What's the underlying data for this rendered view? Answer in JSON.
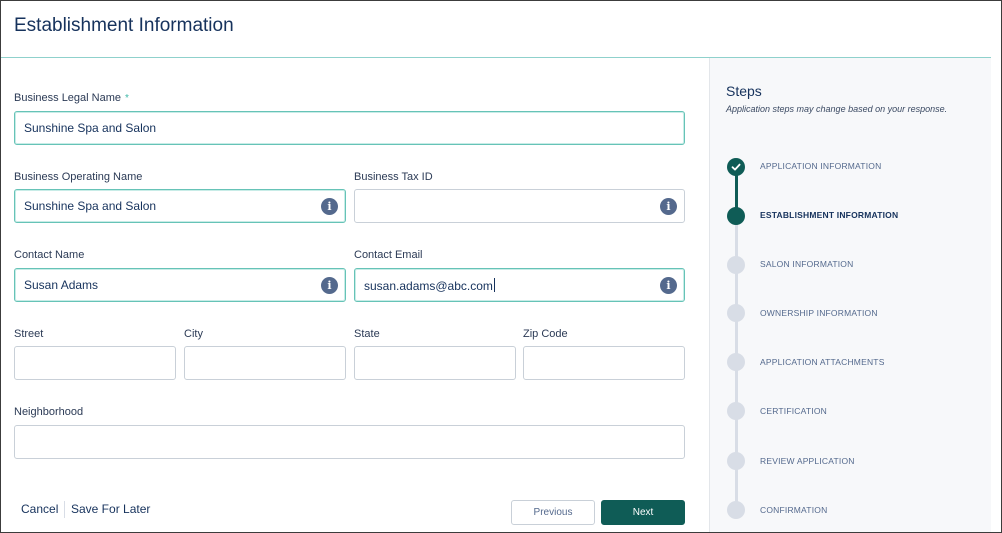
{
  "page": {
    "title": "Establishment Information"
  },
  "form": {
    "business_legal_name": {
      "label": "Business Legal Name",
      "required_mark": "*",
      "value": "Sunshine Spa and Salon"
    },
    "business_operating_name": {
      "label": "Business Operating Name",
      "value": "Sunshine Spa and Salon"
    },
    "business_tax_id": {
      "label": "Business Tax ID",
      "value": ""
    },
    "contact_name": {
      "label": "Contact Name",
      "value": "Susan Adams"
    },
    "contact_email": {
      "label": "Contact Email",
      "value": "susan.adams@abc.com"
    },
    "street": {
      "label": "Street",
      "value": ""
    },
    "city": {
      "label": "City",
      "value": ""
    },
    "state": {
      "label": "State",
      "value": ""
    },
    "zip_code": {
      "label": "Zip Code",
      "value": ""
    },
    "neighborhood": {
      "label": "Neighborhood",
      "value": ""
    },
    "info_icon_glyph": "i"
  },
  "footer": {
    "cancel": "Cancel",
    "save_for_later": "Save For Later",
    "previous": "Previous",
    "next": "Next"
  },
  "steps": {
    "title": "Steps",
    "note": "Application steps may change based on your response.",
    "items": [
      {
        "label": "APPLICATION INFORMATION",
        "state": "done"
      },
      {
        "label": "ESTABLISHMENT INFORMATION",
        "state": "current"
      },
      {
        "label": "SALON INFORMATION",
        "state": "upcoming"
      },
      {
        "label": "OWNERSHIP INFORMATION",
        "state": "upcoming"
      },
      {
        "label": "APPLICATION ATTACHMENTS",
        "state": "upcoming"
      },
      {
        "label": "CERTIFICATION",
        "state": "upcoming"
      },
      {
        "label": "REVIEW APPLICATION",
        "state": "upcoming"
      },
      {
        "label": "CONFIRMATION",
        "state": "upcoming"
      }
    ]
  },
  "colors": {
    "accent": "#0f5c56",
    "focus_border": "#66c3b7",
    "text": "#16325c",
    "pending_step": "#d8dde6"
  }
}
